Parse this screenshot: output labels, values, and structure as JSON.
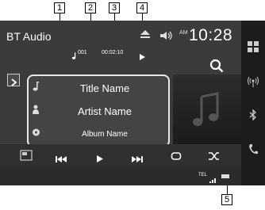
{
  "callouts": [
    "1",
    "2",
    "3",
    "4",
    "5"
  ],
  "screen": {
    "source_name": "BT Audio",
    "clock": "10:28",
    "ampm": "AM",
    "track_number": "001",
    "elapsed_time": "00:02:10",
    "title": "Title Name",
    "artist": "Artist Name",
    "album": "Album Name",
    "tel_status": "TEL"
  },
  "icons": {
    "eject": "eject-icon",
    "volume": "volume-icon",
    "search": "search-icon",
    "play_indicator": "play-icon",
    "expand": "chevron-right-icon",
    "title": "music-note-icon",
    "artist": "person-icon",
    "album": "disc-icon",
    "album_art": "music-note-icon",
    "controls": [
      "display-toggle-icon",
      "previous-icon",
      "play-icon",
      "next-icon",
      "repeat-icon",
      "shuffle-icon"
    ],
    "rail": [
      "apps-grid-icon",
      "radio-wave-icon",
      "bluetooth-icon",
      "phone-icon"
    ]
  },
  "colors": {
    "screen_bg": "#3b3b3b",
    "rail_bg": "#1c1c1c",
    "text": "#ffffff",
    "highlight_border": "#e8e8e8"
  }
}
